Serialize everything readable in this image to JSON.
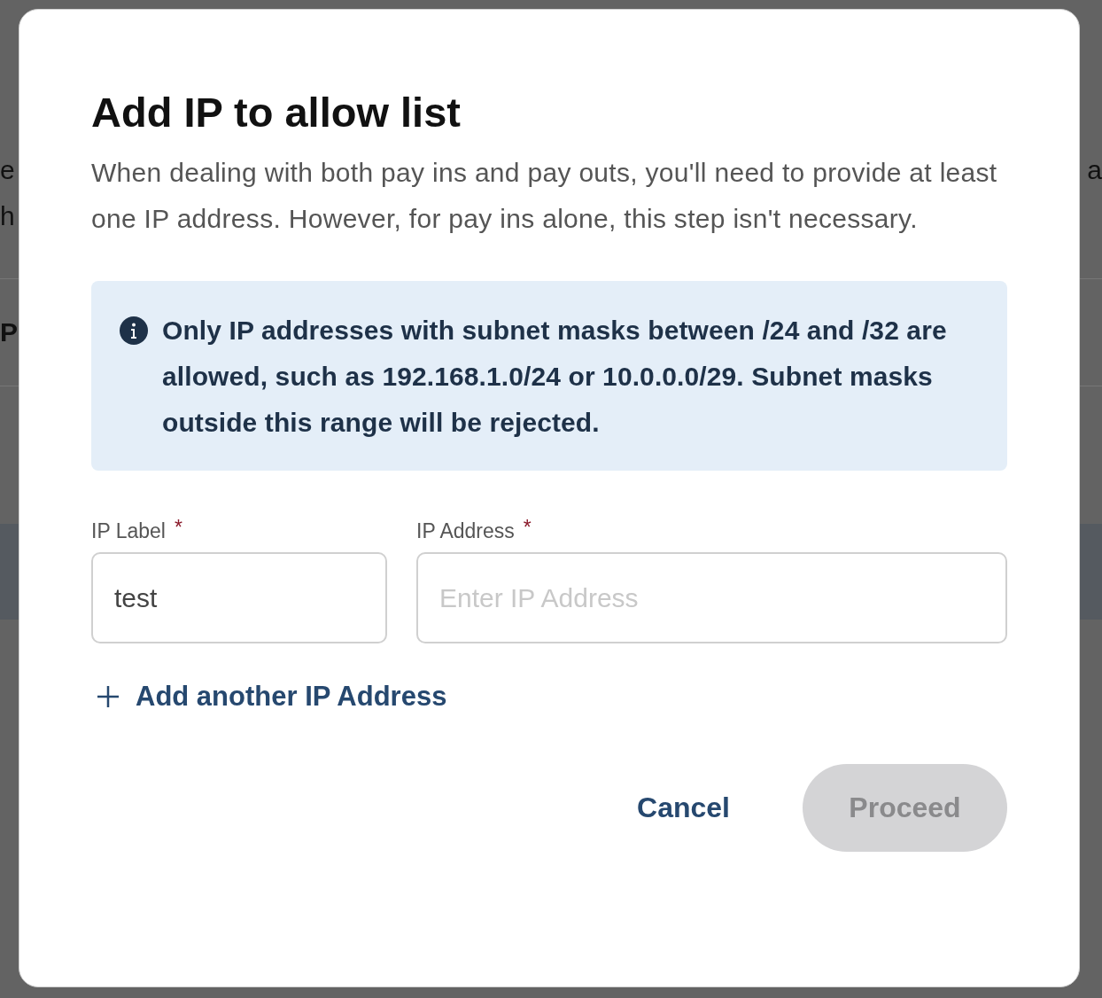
{
  "background": {
    "lines": [
      {
        "kind": "text",
        "left": "e",
        "right": "a"
      },
      {
        "kind": "text",
        "left": "h"
      },
      {
        "kind": "divider"
      },
      {
        "kind": "label",
        "left": "P"
      },
      {
        "kind": "divider"
      },
      {
        "kind": "band"
      }
    ]
  },
  "dialog": {
    "title": "Add IP to allow list",
    "description": "When dealing with both pay ins and pay outs, you'll need to provide at least one IP address. However, for pay ins alone, this step isn't necessary.",
    "notice": {
      "text": "Only IP addresses with subnet masks between /24 and /32 are allowed, such as 192.168.1.0/24 or 10.0.0.0/29. Subnet masks outside this range will be rejected."
    },
    "fields": [
      {
        "label": "IP Label",
        "required": true,
        "required_mark": "*",
        "value": "test"
      },
      {
        "label": "IP Address",
        "required": true,
        "required_mark": "*",
        "placeholder": "Enter IP Address"
      }
    ],
    "add_link": "Add another IP Address",
    "buttons": [
      {
        "kind": "text",
        "label": "Cancel",
        "disabled": false
      },
      {
        "kind": "primary",
        "label": "Proceed",
        "disabled": true
      }
    ]
  }
}
